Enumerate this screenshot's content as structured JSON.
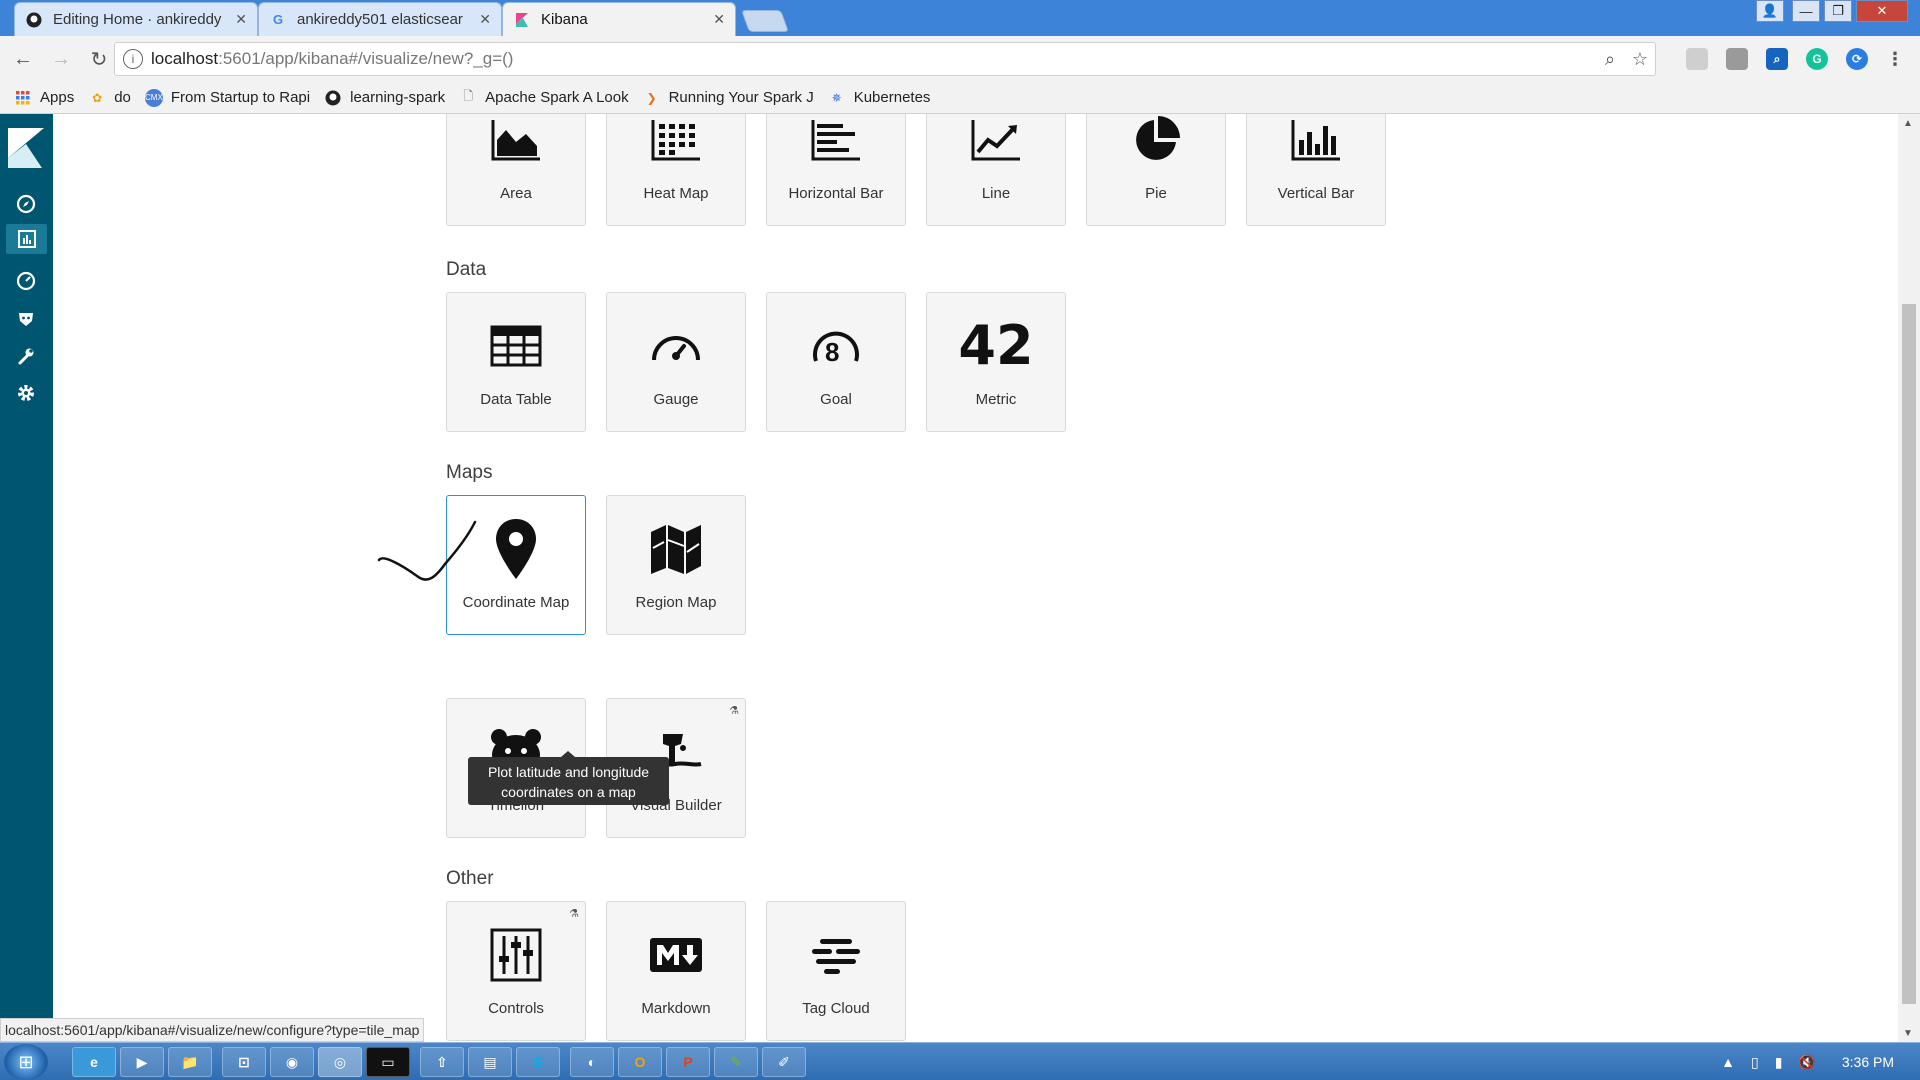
{
  "browser": {
    "tabs": [
      {
        "title": "Editing Home · ankireddy",
        "favicon": "github-icon"
      },
      {
        "title": "ankireddy501 elasticsear",
        "favicon": "google-icon"
      },
      {
        "title": "Kibana",
        "favicon": "kibana-icon"
      }
    ],
    "url_host": "localhost",
    "url_path": ":5601/app/kibana#/visualize/new?_g=()",
    "bookmarks": [
      {
        "label": "Apps",
        "icon": "apps-grid-icon"
      },
      {
        "label": "do",
        "icon": "flower-icon"
      },
      {
        "label": "From Startup to Rapi",
        "icon": "cmx-icon"
      },
      {
        "label": "learning-spark",
        "icon": "github-icon"
      },
      {
        "label": "Apache Spark A Look",
        "icon": "page-icon"
      },
      {
        "label": "Running Your Spark J",
        "icon": "arrow-icon"
      },
      {
        "label": "Kubernetes",
        "icon": "kubernetes-icon"
      }
    ]
  },
  "sections": {
    "data_title": "Data",
    "maps_title": "Maps",
    "other_title": "Other"
  },
  "cards": {
    "area": "Area",
    "heat_map": "Heat Map",
    "horizontal_bar": "Horizontal Bar",
    "line": "Line",
    "pie": "Pie",
    "vertical_bar": "Vertical Bar",
    "data_table": "Data Table",
    "gauge": "Gauge",
    "goal": "Goal",
    "goal_digit": "8",
    "metric": "Metric",
    "metric_value": "42",
    "coordinate_map": "Coordinate Map",
    "region_map": "Region Map",
    "timelion": "Timelion",
    "visual_builder": "Visual Builder",
    "controls": "Controls",
    "markdown": "Markdown",
    "tag_cloud": "Tag Cloud"
  },
  "tooltip": {
    "line1": "Plot latitude and longitude",
    "line2": "coordinates on a map"
  },
  "status_bar": {
    "url": "localhost:5601/app/kibana#/visualize/new/configure?type=tile_map"
  },
  "taskbar": {
    "clock": "3:36 PM"
  },
  "colors": {
    "kibana_sidebar": "#005571",
    "selected_border": "#2d8fd5",
    "tab_strip": "#3d83d8"
  }
}
